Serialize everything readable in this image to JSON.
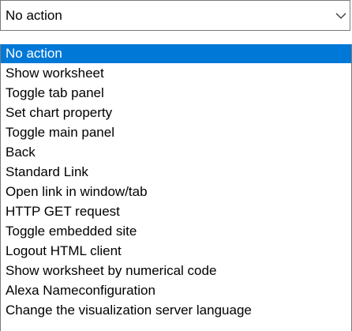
{
  "combo": {
    "value": "No action",
    "arrow_icon": "chevron-down-icon"
  },
  "options": [
    "No action",
    "Show worksheet",
    "Toggle tab panel",
    "Set chart property",
    "Toggle main panel",
    "Back",
    "Standard Link",
    "Open link in window/tab",
    "HTTP GET request",
    "Toggle embedded site",
    "Logout HTML client",
    "Show worksheet by numerical code",
    "Alexa Nameconfiguration",
    "Change the visualization server language"
  ],
  "selected_index": 0,
  "colors": {
    "highlight": "#0078d7",
    "highlight_text": "#ffffff",
    "border": "#7a7a7a"
  }
}
